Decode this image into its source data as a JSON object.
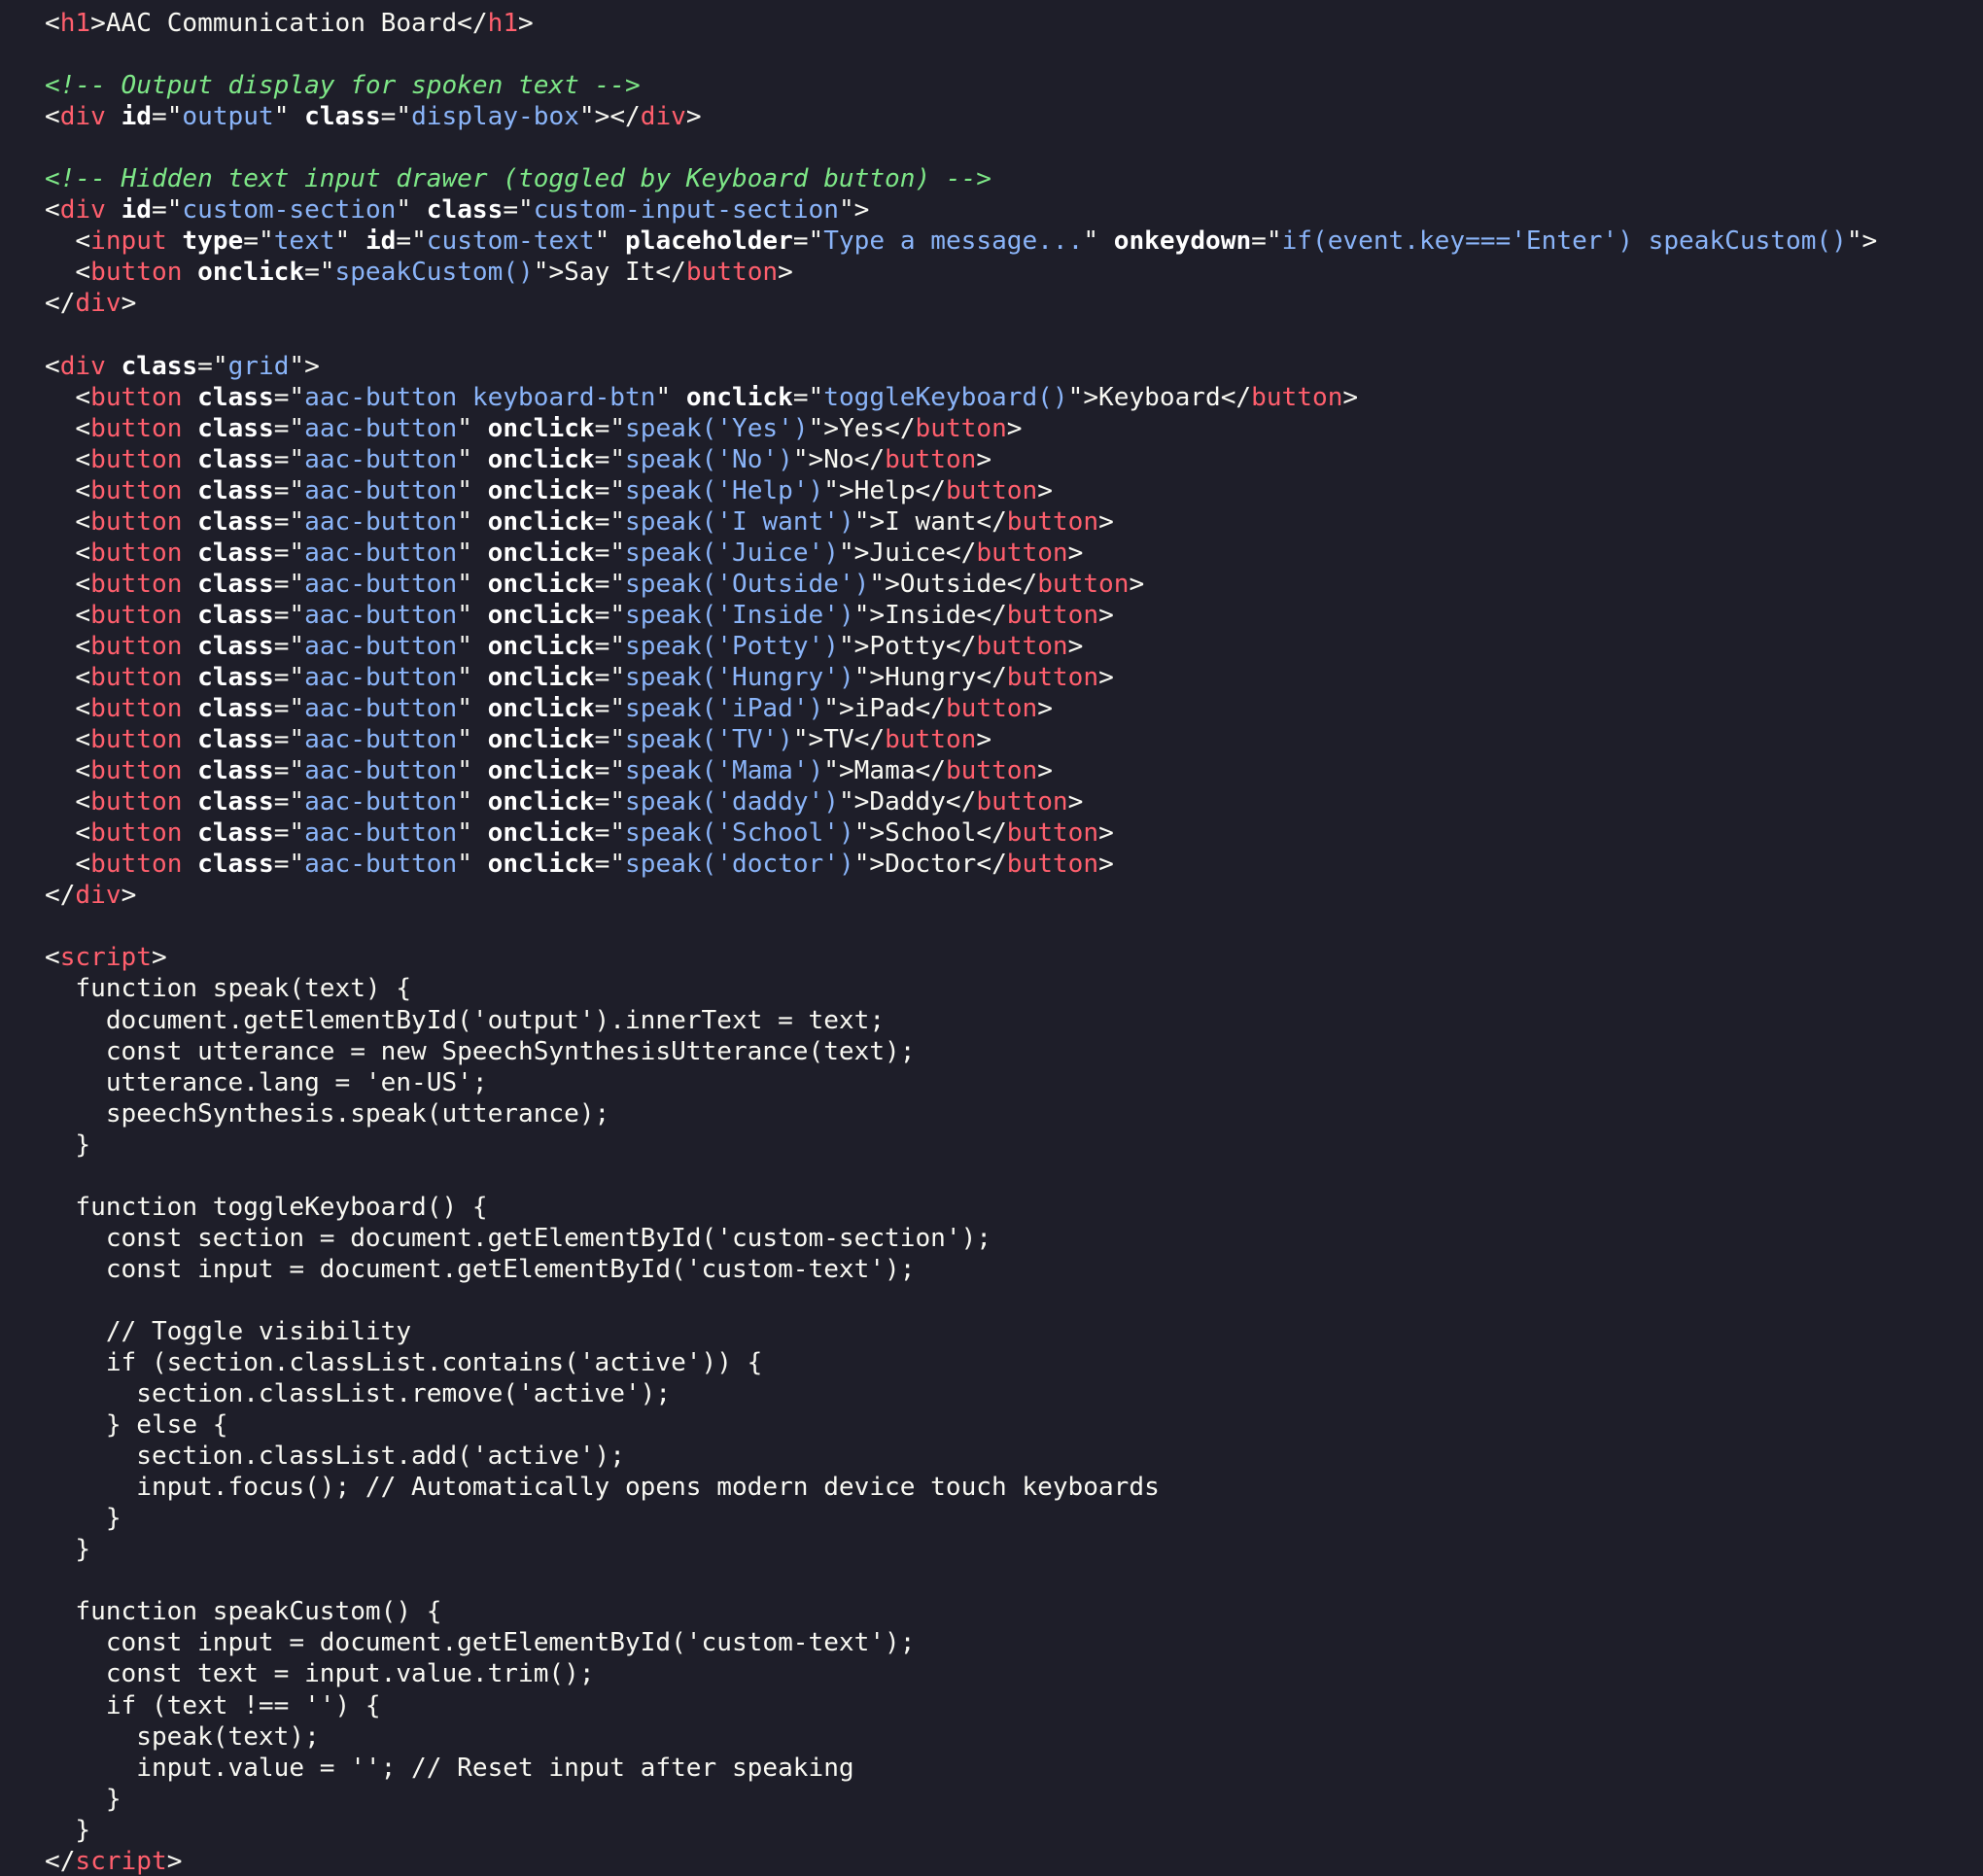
{
  "colors": {
    "background": "#1e1e29",
    "plain": "#f8f8f2",
    "tag": "#ff5f6d",
    "attribute_name": "#ffffff",
    "attribute_value": "#8ab4f8",
    "comment": "#7ee787"
  },
  "lines": [
    [
      [
        "pun",
        "<"
      ],
      [
        "tag",
        "h1"
      ],
      [
        "pun",
        ">AAC Communication Board</"
      ],
      [
        "tag",
        "h1"
      ],
      [
        "pun",
        ">"
      ]
    ],
    [],
    [
      [
        "com",
        "<!-- Output display for spoken text -->"
      ]
    ],
    [
      [
        "pun",
        "<"
      ],
      [
        "tag",
        "div"
      ],
      [
        "pun",
        " "
      ],
      [
        "atn",
        "id"
      ],
      [
        "pun",
        "=\""
      ],
      [
        "atv",
        "output"
      ],
      [
        "pun",
        "\" "
      ],
      [
        "atn",
        "class"
      ],
      [
        "pun",
        "=\""
      ],
      [
        "atv",
        "display-box"
      ],
      [
        "pun",
        "\"></"
      ],
      [
        "tag",
        "div"
      ],
      [
        "pun",
        ">"
      ]
    ],
    [],
    [
      [
        "com",
        "<!-- Hidden text input drawer (toggled by Keyboard button) -->"
      ]
    ],
    [
      [
        "pun",
        "<"
      ],
      [
        "tag",
        "div"
      ],
      [
        "pun",
        " "
      ],
      [
        "atn",
        "id"
      ],
      [
        "pun",
        "=\""
      ],
      [
        "atv",
        "custom-section"
      ],
      [
        "pun",
        "\" "
      ],
      [
        "atn",
        "class"
      ],
      [
        "pun",
        "=\""
      ],
      [
        "atv",
        "custom-input-section"
      ],
      [
        "pun",
        "\">"
      ]
    ],
    [
      [
        "pun",
        "  <"
      ],
      [
        "tag",
        "input"
      ],
      [
        "pun",
        " "
      ],
      [
        "atn",
        "type"
      ],
      [
        "pun",
        "=\""
      ],
      [
        "atv",
        "text"
      ],
      [
        "pun",
        "\" "
      ],
      [
        "atn",
        "id"
      ],
      [
        "pun",
        "=\""
      ],
      [
        "atv",
        "custom-text"
      ],
      [
        "pun",
        "\" "
      ],
      [
        "atn",
        "placeholder"
      ],
      [
        "pun",
        "=\""
      ],
      [
        "atv",
        "Type a message..."
      ],
      [
        "pun",
        "\" "
      ],
      [
        "atn",
        "onkeydown"
      ],
      [
        "pun",
        "=\""
      ],
      [
        "atv",
        "if(event.key==='Enter') speakCustom()"
      ],
      [
        "pun",
        "\">"
      ]
    ],
    [
      [
        "pun",
        "  <"
      ],
      [
        "tag",
        "button"
      ],
      [
        "pun",
        " "
      ],
      [
        "atn",
        "onclick"
      ],
      [
        "pun",
        "=\""
      ],
      [
        "atv",
        "speakCustom()"
      ],
      [
        "pun",
        "\">Say It</"
      ],
      [
        "tag",
        "button"
      ],
      [
        "pun",
        ">"
      ]
    ],
    [
      [
        "pun",
        "</"
      ],
      [
        "tag",
        "div"
      ],
      [
        "pun",
        ">"
      ]
    ],
    [],
    [
      [
        "pun",
        "<"
      ],
      [
        "tag",
        "div"
      ],
      [
        "pun",
        " "
      ],
      [
        "atn",
        "class"
      ],
      [
        "pun",
        "=\""
      ],
      [
        "atv",
        "grid"
      ],
      [
        "pun",
        "\">"
      ]
    ],
    [
      [
        "pun",
        "  <"
      ],
      [
        "tag",
        "button"
      ],
      [
        "pun",
        " "
      ],
      [
        "atn",
        "class"
      ],
      [
        "pun",
        "=\""
      ],
      [
        "atv",
        "aac-button keyboard-btn"
      ],
      [
        "pun",
        "\" "
      ],
      [
        "atn",
        "onclick"
      ],
      [
        "pun",
        "=\""
      ],
      [
        "atv",
        "toggleKeyboard()"
      ],
      [
        "pun",
        "\">Keyboard</"
      ],
      [
        "tag",
        "button"
      ],
      [
        "pun",
        ">"
      ]
    ],
    [
      [
        "pun",
        "  <"
      ],
      [
        "tag",
        "button"
      ],
      [
        "pun",
        " "
      ],
      [
        "atn",
        "class"
      ],
      [
        "pun",
        "=\""
      ],
      [
        "atv",
        "aac-button"
      ],
      [
        "pun",
        "\" "
      ],
      [
        "atn",
        "onclick"
      ],
      [
        "pun",
        "=\""
      ],
      [
        "atv",
        "speak('Yes')"
      ],
      [
        "pun",
        "\">Yes</"
      ],
      [
        "tag",
        "button"
      ],
      [
        "pun",
        ">"
      ]
    ],
    [
      [
        "pun",
        "  <"
      ],
      [
        "tag",
        "button"
      ],
      [
        "pun",
        " "
      ],
      [
        "atn",
        "class"
      ],
      [
        "pun",
        "=\""
      ],
      [
        "atv",
        "aac-button"
      ],
      [
        "pun",
        "\" "
      ],
      [
        "atn",
        "onclick"
      ],
      [
        "pun",
        "=\""
      ],
      [
        "atv",
        "speak('No')"
      ],
      [
        "pun",
        "\">No</"
      ],
      [
        "tag",
        "button"
      ],
      [
        "pun",
        ">"
      ]
    ],
    [
      [
        "pun",
        "  <"
      ],
      [
        "tag",
        "button"
      ],
      [
        "pun",
        " "
      ],
      [
        "atn",
        "class"
      ],
      [
        "pun",
        "=\""
      ],
      [
        "atv",
        "aac-button"
      ],
      [
        "pun",
        "\" "
      ],
      [
        "atn",
        "onclick"
      ],
      [
        "pun",
        "=\""
      ],
      [
        "atv",
        "speak('Help')"
      ],
      [
        "pun",
        "\">Help</"
      ],
      [
        "tag",
        "button"
      ],
      [
        "pun",
        ">"
      ]
    ],
    [
      [
        "pun",
        "  <"
      ],
      [
        "tag",
        "button"
      ],
      [
        "pun",
        " "
      ],
      [
        "atn",
        "class"
      ],
      [
        "pun",
        "=\""
      ],
      [
        "atv",
        "aac-button"
      ],
      [
        "pun",
        "\" "
      ],
      [
        "atn",
        "onclick"
      ],
      [
        "pun",
        "=\""
      ],
      [
        "atv",
        "speak('I want')"
      ],
      [
        "pun",
        "\">I want</"
      ],
      [
        "tag",
        "button"
      ],
      [
        "pun",
        ">"
      ]
    ],
    [
      [
        "pun",
        "  <"
      ],
      [
        "tag",
        "button"
      ],
      [
        "pun",
        " "
      ],
      [
        "atn",
        "class"
      ],
      [
        "pun",
        "=\""
      ],
      [
        "atv",
        "aac-button"
      ],
      [
        "pun",
        "\" "
      ],
      [
        "atn",
        "onclick"
      ],
      [
        "pun",
        "=\""
      ],
      [
        "atv",
        "speak('Juice')"
      ],
      [
        "pun",
        "\">Juice</"
      ],
      [
        "tag",
        "button"
      ],
      [
        "pun",
        ">"
      ]
    ],
    [
      [
        "pun",
        "  <"
      ],
      [
        "tag",
        "button"
      ],
      [
        "pun",
        " "
      ],
      [
        "atn",
        "class"
      ],
      [
        "pun",
        "=\""
      ],
      [
        "atv",
        "aac-button"
      ],
      [
        "pun",
        "\" "
      ],
      [
        "atn",
        "onclick"
      ],
      [
        "pun",
        "=\""
      ],
      [
        "atv",
        "speak('Outside')"
      ],
      [
        "pun",
        "\">Outside</"
      ],
      [
        "tag",
        "button"
      ],
      [
        "pun",
        ">"
      ]
    ],
    [
      [
        "pun",
        "  <"
      ],
      [
        "tag",
        "button"
      ],
      [
        "pun",
        " "
      ],
      [
        "atn",
        "class"
      ],
      [
        "pun",
        "=\""
      ],
      [
        "atv",
        "aac-button"
      ],
      [
        "pun",
        "\" "
      ],
      [
        "atn",
        "onclick"
      ],
      [
        "pun",
        "=\""
      ],
      [
        "atv",
        "speak('Inside')"
      ],
      [
        "pun",
        "\">Inside</"
      ],
      [
        "tag",
        "button"
      ],
      [
        "pun",
        ">"
      ]
    ],
    [
      [
        "pun",
        "  <"
      ],
      [
        "tag",
        "button"
      ],
      [
        "pun",
        " "
      ],
      [
        "atn",
        "class"
      ],
      [
        "pun",
        "=\""
      ],
      [
        "atv",
        "aac-button"
      ],
      [
        "pun",
        "\" "
      ],
      [
        "atn",
        "onclick"
      ],
      [
        "pun",
        "=\""
      ],
      [
        "atv",
        "speak('Potty')"
      ],
      [
        "pun",
        "\">Potty</"
      ],
      [
        "tag",
        "button"
      ],
      [
        "pun",
        ">"
      ]
    ],
    [
      [
        "pun",
        "  <"
      ],
      [
        "tag",
        "button"
      ],
      [
        "pun",
        " "
      ],
      [
        "atn",
        "class"
      ],
      [
        "pun",
        "=\""
      ],
      [
        "atv",
        "aac-button"
      ],
      [
        "pun",
        "\" "
      ],
      [
        "atn",
        "onclick"
      ],
      [
        "pun",
        "=\""
      ],
      [
        "atv",
        "speak('Hungry')"
      ],
      [
        "pun",
        "\">Hungry</"
      ],
      [
        "tag",
        "button"
      ],
      [
        "pun",
        ">"
      ]
    ],
    [
      [
        "pun",
        "  <"
      ],
      [
        "tag",
        "button"
      ],
      [
        "pun",
        " "
      ],
      [
        "atn",
        "class"
      ],
      [
        "pun",
        "=\""
      ],
      [
        "atv",
        "aac-button"
      ],
      [
        "pun",
        "\" "
      ],
      [
        "atn",
        "onclick"
      ],
      [
        "pun",
        "=\""
      ],
      [
        "atv",
        "speak('iPad')"
      ],
      [
        "pun",
        "\">iPad</"
      ],
      [
        "tag",
        "button"
      ],
      [
        "pun",
        ">"
      ]
    ],
    [
      [
        "pun",
        "  <"
      ],
      [
        "tag",
        "button"
      ],
      [
        "pun",
        " "
      ],
      [
        "atn",
        "class"
      ],
      [
        "pun",
        "=\""
      ],
      [
        "atv",
        "aac-button"
      ],
      [
        "pun",
        "\" "
      ],
      [
        "atn",
        "onclick"
      ],
      [
        "pun",
        "=\""
      ],
      [
        "atv",
        "speak('TV')"
      ],
      [
        "pun",
        "\">TV</"
      ],
      [
        "tag",
        "button"
      ],
      [
        "pun",
        ">"
      ]
    ],
    [
      [
        "pun",
        "  <"
      ],
      [
        "tag",
        "button"
      ],
      [
        "pun",
        " "
      ],
      [
        "atn",
        "class"
      ],
      [
        "pun",
        "=\""
      ],
      [
        "atv",
        "aac-button"
      ],
      [
        "pun",
        "\" "
      ],
      [
        "atn",
        "onclick"
      ],
      [
        "pun",
        "=\""
      ],
      [
        "atv",
        "speak('Mama')"
      ],
      [
        "pun",
        "\">Mama</"
      ],
      [
        "tag",
        "button"
      ],
      [
        "pun",
        ">"
      ]
    ],
    [
      [
        "pun",
        "  <"
      ],
      [
        "tag",
        "button"
      ],
      [
        "pun",
        " "
      ],
      [
        "atn",
        "class"
      ],
      [
        "pun",
        "=\""
      ],
      [
        "atv",
        "aac-button"
      ],
      [
        "pun",
        "\" "
      ],
      [
        "atn",
        "onclick"
      ],
      [
        "pun",
        "=\""
      ],
      [
        "atv",
        "speak('daddy')"
      ],
      [
        "pun",
        "\">Daddy</"
      ],
      [
        "tag",
        "button"
      ],
      [
        "pun",
        ">"
      ]
    ],
    [
      [
        "pun",
        "  <"
      ],
      [
        "tag",
        "button"
      ],
      [
        "pun",
        " "
      ],
      [
        "atn",
        "class"
      ],
      [
        "pun",
        "=\""
      ],
      [
        "atv",
        "aac-button"
      ],
      [
        "pun",
        "\" "
      ],
      [
        "atn",
        "onclick"
      ],
      [
        "pun",
        "=\""
      ],
      [
        "atv",
        "speak('School')"
      ],
      [
        "pun",
        "\">School</"
      ],
      [
        "tag",
        "button"
      ],
      [
        "pun",
        ">"
      ]
    ],
    [
      [
        "pun",
        "  <"
      ],
      [
        "tag",
        "button"
      ],
      [
        "pun",
        " "
      ],
      [
        "atn",
        "class"
      ],
      [
        "pun",
        "=\""
      ],
      [
        "atv",
        "aac-button"
      ],
      [
        "pun",
        "\" "
      ],
      [
        "atn",
        "onclick"
      ],
      [
        "pun",
        "=\""
      ],
      [
        "atv",
        "speak('doctor')"
      ],
      [
        "pun",
        "\">Doctor</"
      ],
      [
        "tag",
        "button"
      ],
      [
        "pun",
        ">"
      ]
    ],
    [
      [
        "pun",
        "</"
      ],
      [
        "tag",
        "div"
      ],
      [
        "pun",
        ">"
      ]
    ],
    [],
    [
      [
        "pun",
        "<"
      ],
      [
        "tag",
        "script"
      ],
      [
        "pun",
        ">"
      ]
    ],
    [
      [
        "pln",
        "  function speak(text) {"
      ]
    ],
    [
      [
        "pln",
        "    document.getElementById('output').innerText = text;"
      ]
    ],
    [
      [
        "pln",
        "    const utterance = new SpeechSynthesisUtterance(text);"
      ]
    ],
    [
      [
        "pln",
        "    utterance.lang = 'en-US';"
      ]
    ],
    [
      [
        "pln",
        "    speechSynthesis.speak(utterance);"
      ]
    ],
    [
      [
        "pln",
        "  }"
      ]
    ],
    [],
    [
      [
        "pln",
        "  function toggleKeyboard() {"
      ]
    ],
    [
      [
        "pln",
        "    const section = document.getElementById('custom-section');"
      ]
    ],
    [
      [
        "pln",
        "    const input = document.getElementById('custom-text');"
      ]
    ],
    [],
    [
      [
        "pln",
        "    // Toggle visibility"
      ]
    ],
    [
      [
        "pln",
        "    if (section.classList.contains('active')) {"
      ]
    ],
    [
      [
        "pln",
        "      section.classList.remove('active');"
      ]
    ],
    [
      [
        "pln",
        "    } else {"
      ]
    ],
    [
      [
        "pln",
        "      section.classList.add('active');"
      ]
    ],
    [
      [
        "pln",
        "      input.focus(); // Automatically opens modern device touch keyboards"
      ]
    ],
    [
      [
        "pln",
        "    }"
      ]
    ],
    [
      [
        "pln",
        "  }"
      ]
    ],
    [],
    [
      [
        "pln",
        "  function speakCustom() {"
      ]
    ],
    [
      [
        "pln",
        "    const input = document.getElementById('custom-text');"
      ]
    ],
    [
      [
        "pln",
        "    const text = input.value.trim();"
      ]
    ],
    [
      [
        "pln",
        "    if (text !== '') {"
      ]
    ],
    [
      [
        "pln",
        "      speak(text);"
      ]
    ],
    [
      [
        "pln",
        "      input.value = ''; // Reset input after speaking"
      ]
    ],
    [
      [
        "pln",
        "    }"
      ]
    ],
    [
      [
        "pln",
        "  }"
      ]
    ],
    [
      [
        "pun",
        "</"
      ],
      [
        "tag",
        "script"
      ],
      [
        "pun",
        ">"
      ]
    ]
  ]
}
